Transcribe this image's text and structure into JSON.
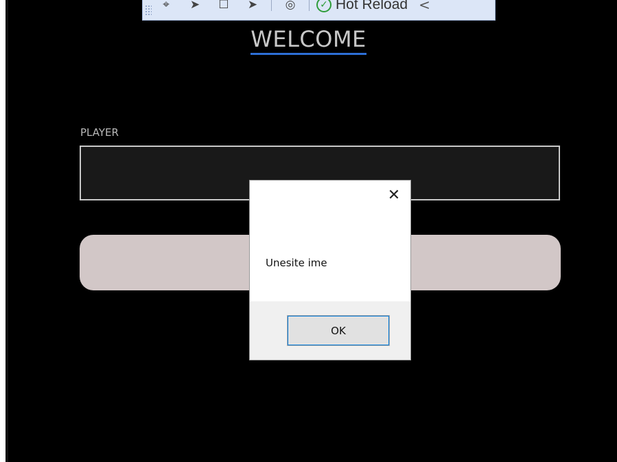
{
  "toolbar": {
    "icons": [
      "drag-handle-icon",
      "select-element-icon",
      "pointer-icon",
      "display-layout-icon",
      "track-focus-icon",
      "theme-icon"
    ],
    "hot_reload_label": "Hot Reload",
    "chevron": "<"
  },
  "page": {
    "title": "WELCOME",
    "player_label": "PLAYER",
    "player_value": "",
    "button_label": ""
  },
  "dialog": {
    "message": "Unesite ime",
    "close_glyph": "✕",
    "ok_label": "OK"
  },
  "colors": {
    "background": "#000000",
    "title_underline": "#2d6fd6",
    "button": "#d2c7c7",
    "toolbar": "#dce6f7",
    "hot_reload_check": "#2e9c3a"
  }
}
